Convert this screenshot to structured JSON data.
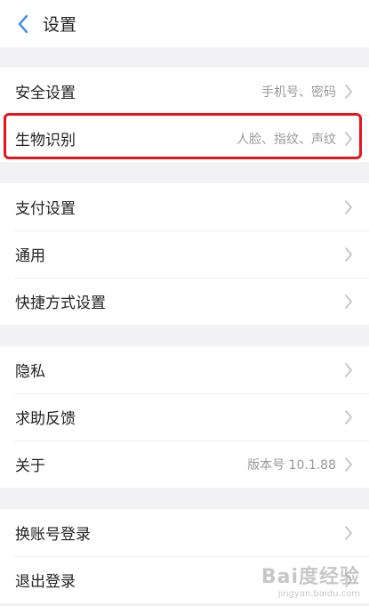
{
  "header": {
    "title": "设置"
  },
  "sections": [
    {
      "items": [
        {
          "label": "安全设置",
          "value": "手机号、密码"
        },
        {
          "label": "生物识别",
          "value": "人脸、指纹、声纹"
        }
      ]
    },
    {
      "items": [
        {
          "label": "支付设置",
          "value": ""
        },
        {
          "label": "通用",
          "value": ""
        },
        {
          "label": "快捷方式设置",
          "value": ""
        }
      ]
    },
    {
      "items": [
        {
          "label": "隐私",
          "value": ""
        },
        {
          "label": "求助反馈",
          "value": ""
        },
        {
          "label": "关于",
          "value": "版本号 10.1.88"
        }
      ]
    },
    {
      "items": [
        {
          "label": "换账号登录",
          "value": ""
        },
        {
          "label": "退出登录",
          "value": ""
        }
      ]
    }
  ],
  "watermark": {
    "logo": "Bai度经验",
    "url": "jingyan.baidu.com"
  },
  "colors": {
    "accent": "#2f8cf0",
    "highlight": "#e8141c",
    "background": "#f2f2f4"
  },
  "icons": {
    "back": "chevron-left-icon",
    "row_arrow": "chevron-right-icon"
  }
}
